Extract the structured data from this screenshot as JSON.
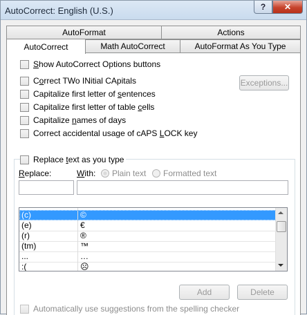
{
  "window": {
    "title": "AutoCorrect: English (U.S.)",
    "help_glyph": "?",
    "close_glyph": "✕"
  },
  "tabs": {
    "top": [
      "AutoFormat",
      "Actions"
    ],
    "bottom": [
      "AutoCorrect",
      "Math AutoCorrect",
      "AutoFormat As You Type"
    ],
    "active": "AutoCorrect"
  },
  "options": {
    "show_buttons": {
      "ul": "S",
      "rest": "how AutoCorrect Options buttons"
    },
    "two_initials": {
      "pre": "C",
      "ul": "o",
      "rest": "rrect TWo INitial CApitals"
    },
    "first_sentence": {
      "pre": "Capitalize first letter of ",
      "ul": "s",
      "rest": "entences"
    },
    "first_table": {
      "pre": "Capitalize first letter of table ",
      "ul": "c",
      "rest": "ells"
    },
    "names_days": {
      "pre": "Capitalize ",
      "ul": "n",
      "rest": "ames of days"
    },
    "caps_lock": {
      "pre": "Correct accidental usage of cAPS ",
      "ul": "L",
      "rest": "OCK key"
    },
    "exceptions_button": "Exceptions..."
  },
  "replace_section": {
    "checkbox": {
      "pre": "Replace ",
      "ul": "t",
      "rest": "ext as you type"
    },
    "replace_label": {
      "ul": "R",
      "rest": "eplace:"
    },
    "with_label": {
      "ul": "W",
      "rest": "ith:"
    },
    "plain_text": "Plain text",
    "formatted_text": "Formatted text",
    "replace_value": "",
    "with_value": ""
  },
  "entries": [
    {
      "replace": "(c)",
      "with": "©",
      "selected": true
    },
    {
      "replace": "(e)",
      "with": "€",
      "selected": false
    },
    {
      "replace": "(r)",
      "with": "®",
      "selected": false
    },
    {
      "replace": "(tm)",
      "with": "™",
      "selected": false
    },
    {
      "replace": "...",
      "with": "…",
      "selected": false
    },
    {
      "replace": ":(",
      "with": "☹",
      "selected": false
    }
  ],
  "buttons": {
    "add": "Add",
    "delete": "Delete"
  },
  "suggestions": "Automatically use suggestions from the spelling checker"
}
